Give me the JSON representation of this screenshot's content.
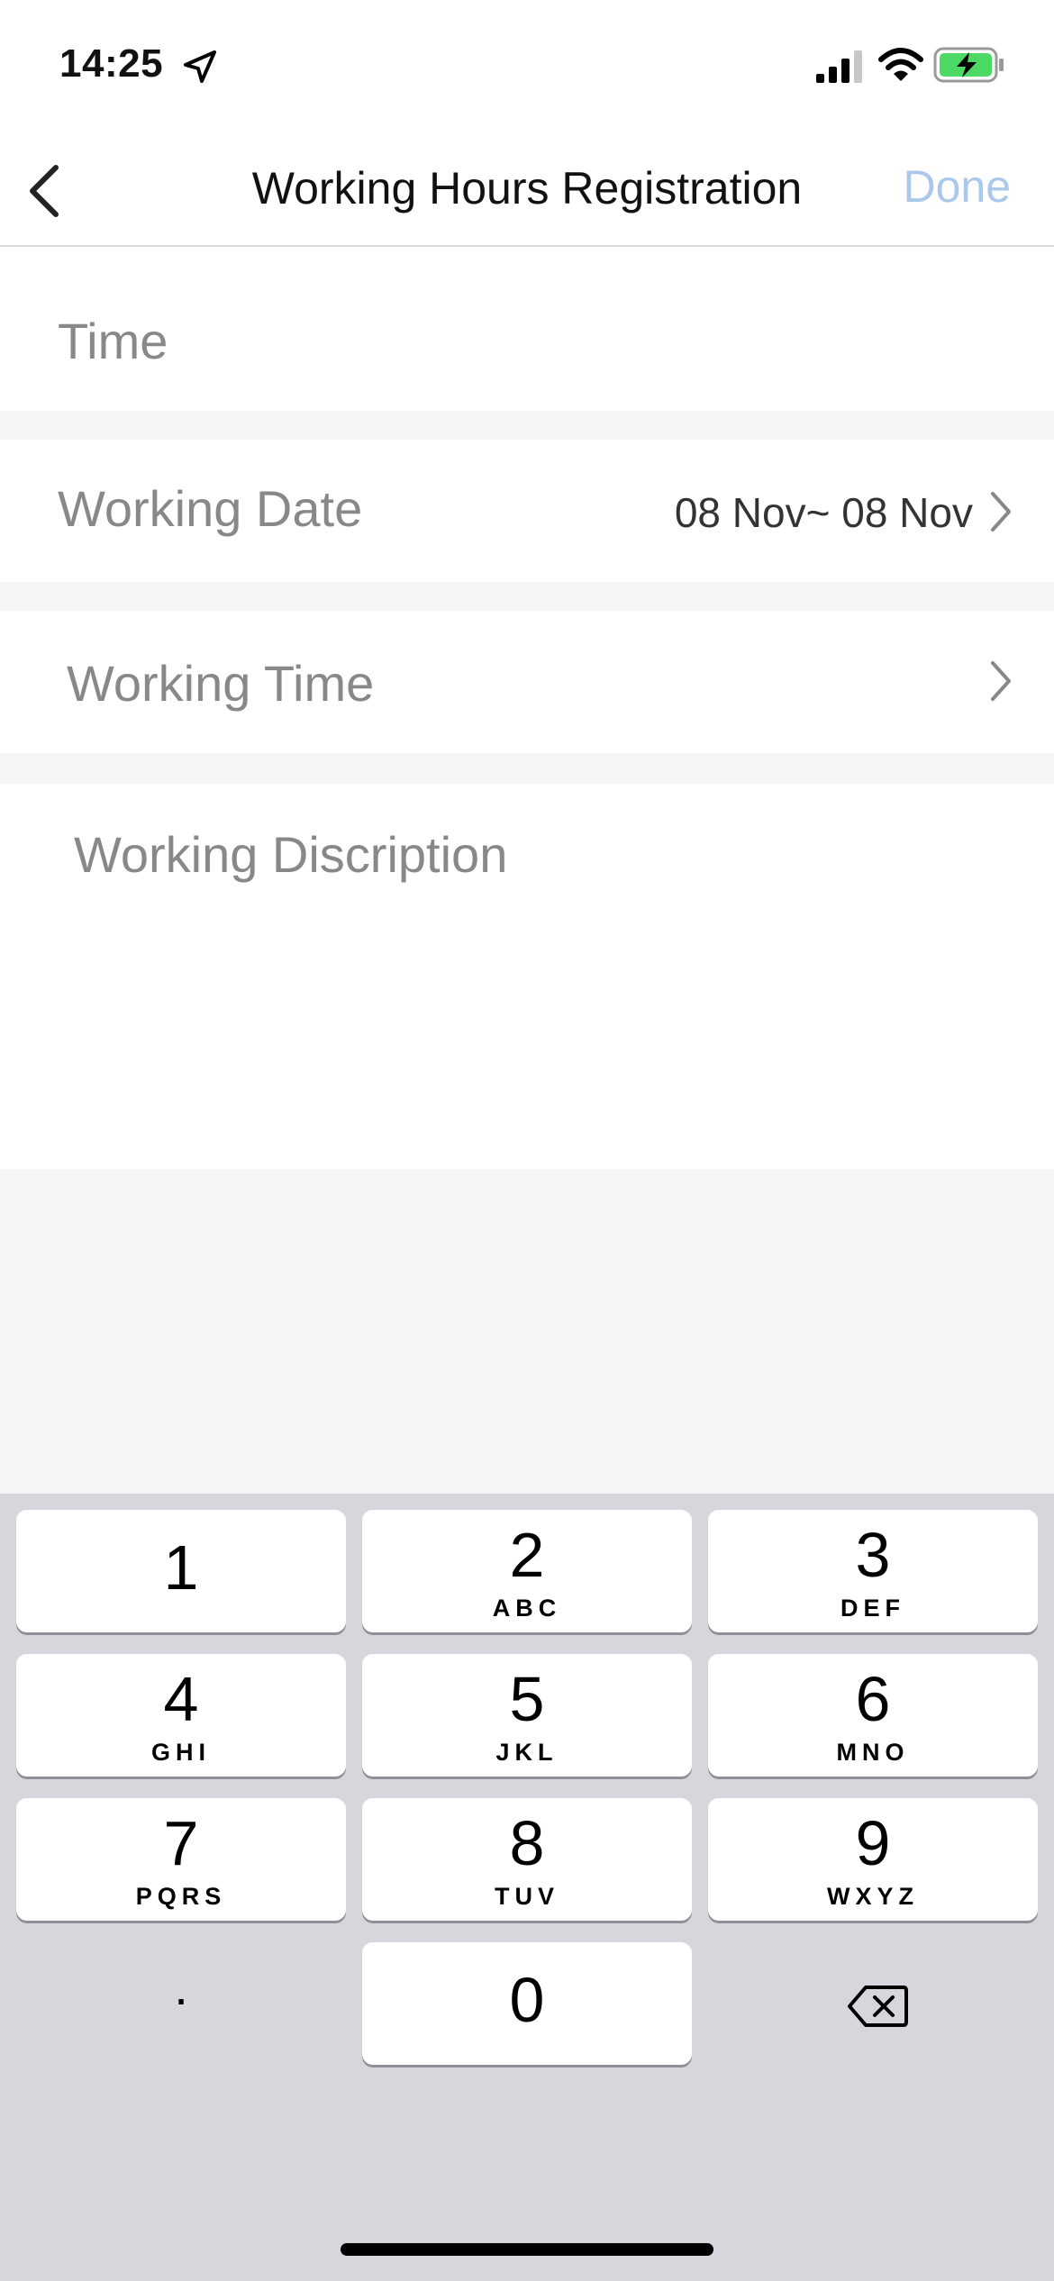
{
  "status_bar": {
    "time": "14:25",
    "icons": [
      "location-arrow-icon",
      "cellular-signal-icon",
      "wifi-icon",
      "battery-charging-icon"
    ]
  },
  "nav": {
    "title": "Working Hours Registration",
    "done_label": "Done",
    "done_color": "#a9c8ec"
  },
  "form": {
    "time_label": "Time",
    "working_date_label": "Working Date",
    "working_date_value": "08 Nov~ 08 Nov",
    "working_time_label": "Working Time",
    "description_placeholder": "Working Discription"
  },
  "keyboard": {
    "keys": [
      {
        "digit": "1",
        "letters": ""
      },
      {
        "digit": "2",
        "letters": "ABC"
      },
      {
        "digit": "3",
        "letters": "DEF"
      },
      {
        "digit": "4",
        "letters": "GHI"
      },
      {
        "digit": "5",
        "letters": "JKL"
      },
      {
        "digit": "6",
        "letters": "MNO"
      },
      {
        "digit": "7",
        "letters": "PQRS"
      },
      {
        "digit": "8",
        "letters": "TUV"
      },
      {
        "digit": "9",
        "letters": "WXYZ"
      }
    ],
    "dot_label": ".",
    "zero_label": "0"
  }
}
